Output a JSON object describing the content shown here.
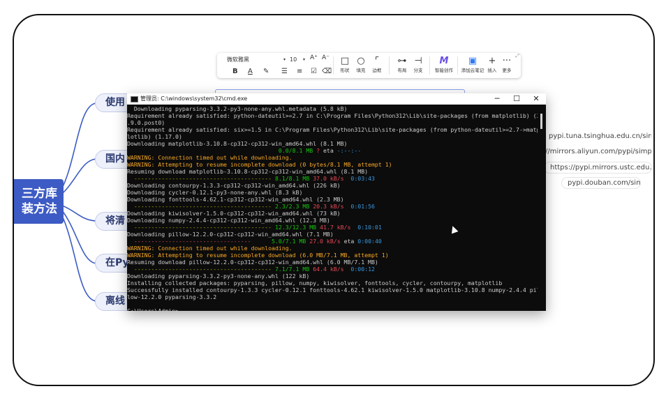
{
  "root_node": {
    "line1": "三方库",
    "line2": "装方法"
  },
  "branches": [
    "使用",
    "国内",
    "将清",
    "在Py",
    "离线"
  ],
  "mirror_links": [
    "pypi.tuna.tsinghua.edu.cn/simple",
    "//mirrors.aliyun.com/pypi/simple/",
    "https://pypi.mirrors.ustc.edu.cn/sim",
    "pypi.douban.com/simple"
  ],
  "toolbar": {
    "font_name": "微软雅黑",
    "font_size": "10",
    "grow_font": "A⁺",
    "shrink_font": "A⁻",
    "bold": "B",
    "font_color": "A",
    "highlight": "✎",
    "list": "☰",
    "align": "≡",
    "tools": [
      {
        "icon": "□",
        "label": "形状",
        "name": "shape"
      },
      {
        "icon": "○",
        "label": "填充",
        "name": "fill"
      },
      {
        "icon": "⌜",
        "label": "边框",
        "name": "border"
      },
      {
        "icon": "⊶",
        "label": "布局",
        "name": "layout"
      },
      {
        "icon": "⊣",
        "label": "分支",
        "name": "branch"
      },
      {
        "icon": "M",
        "label": "智能创作",
        "name": "ai-create"
      },
      {
        "icon": "▣",
        "label": "添加云笔记",
        "name": "add-cloud-note"
      },
      {
        "icon": "+",
        "label": "插入",
        "name": "insert"
      },
      {
        "icon": "···",
        "label": "更多",
        "name": "more"
      }
    ],
    "colors": {
      "ai": "#6b4de6",
      "note": "#2f7bf5"
    }
  },
  "cmd_window": {
    "title": "管理员: C:\\windows\\system32\\cmd.exe",
    "minimize": "─",
    "maximize": "☐",
    "close": "✕",
    "lines": [
      [
        {
          "t": "  Downloading pyparsing-3.3.2-py3-none-any.whl.metadata (5.8 kB)",
          "c": "#cccccc"
        }
      ],
      [
        {
          "t": "Requirement already satisfied: python-dateutil>=2.7 in C:\\Program Files\\Python312\\Lib\\site-packages (from matplotlib) (2",
          "c": "#cccccc"
        }
      ],
      [
        {
          "t": ".9.0.post0)",
          "c": "#cccccc"
        }
      ],
      [
        {
          "t": "Requirement already satisfied: six>=1.5 in C:\\Program Files\\Python312\\Lib\\site-packages (from python-dateutil>=2.7->matp",
          "c": "#cccccc"
        }
      ],
      [
        {
          "t": "lotlib) (1.17.0)",
          "c": "#cccccc"
        }
      ],
      [
        {
          "t": "Downloading matplotlib-3.10.8-cp312-cp312-win_amd64.whl (8.1 MB)",
          "c": "#cccccc"
        }
      ],
      [
        {
          "t": "                                            ",
          "c": "#cccccc"
        },
        {
          "t": "0.0/8.1 MB",
          "c": "#16c60c"
        },
        {
          "t": " ? ",
          "c": "#e74856"
        },
        {
          "t": "eta ",
          "c": "#cccccc"
        },
        {
          "t": "-:--:--",
          "c": "#3a96dd"
        }
      ],
      [
        {
          "t": "WARNING: Connection timed out while downloading.",
          "c": "#f9a825"
        }
      ],
      [
        {
          "t": "WARNING: Attempting to resume incomplete download (0 bytes/8.1 MB, attempt 1)",
          "c": "#f9a825"
        }
      ],
      [
        {
          "t": "Resuming download matplotlib-3.10.8-cp312-cp312-win_amd64.whl (8.1 MB)",
          "c": "#cccccc"
        }
      ],
      [
        {
          "t": "  ----------------------------------------",
          "c": "#b1b100"
        },
        {
          "t": " 8.1/8.1 MB",
          "c": "#16c60c"
        },
        {
          "t": " 37.0 kB/s",
          "c": "#e74856"
        },
        {
          "t": "  0:03:43",
          "c": "#3a96dd"
        }
      ],
      [
        {
          "t": "Downloading contourpy-1.3.3-cp312-cp312-win_amd64.whl (226 kB)",
          "c": "#cccccc"
        }
      ],
      [
        {
          "t": "Downloading cycler-0.12.1-py3-none-any.whl (8.3 kB)",
          "c": "#cccccc"
        }
      ],
      [
        {
          "t": "Downloading fonttools-4.62.1-cp312-cp312-win_amd64.whl (2.3 MB)",
          "c": "#cccccc"
        }
      ],
      [
        {
          "t": "  ----------------------------------------",
          "c": "#b1b100"
        },
        {
          "t": " 2.3/2.3 MB",
          "c": "#16c60c"
        },
        {
          "t": " 20.3 kB/s",
          "c": "#e74856"
        },
        {
          "t": "  0:01:56",
          "c": "#3a96dd"
        }
      ],
      [
        {
          "t": "Downloading kiwisolver-1.5.0-cp312-cp312-win_amd64.whl (73 kB)",
          "c": "#cccccc"
        }
      ],
      [
        {
          "t": "Downloading numpy-2.4.4-cp312-cp312-win_amd64.whl (12.3 MB)",
          "c": "#cccccc"
        }
      ],
      [
        {
          "t": "  ----------------------------------------",
          "c": "#b1b100"
        },
        {
          "t": " 12.3/12.3 MB",
          "c": "#16c60c"
        },
        {
          "t": " 41.7 kB/s",
          "c": "#e74856"
        },
        {
          "t": "  0:10:01",
          "c": "#3a96dd"
        }
      ],
      [
        {
          "t": "Downloading pillow-12.2.0-cp312-cp312-win_amd64.whl (7.1 MB)",
          "c": "#cccccc"
        }
      ],
      [
        {
          "t": "  ----------------------------------",
          "c": "#e74856"
        },
        {
          "t": "      5.0/7.1 MB",
          "c": "#16c60c"
        },
        {
          "t": " 27.0 kB/s",
          "c": "#e74856"
        },
        {
          "t": " eta ",
          "c": "#cccccc"
        },
        {
          "t": "0:00:40",
          "c": "#3a96dd"
        }
      ],
      [
        {
          "t": "WARNING: Connection timed out while downloading.",
          "c": "#f9a825"
        }
      ],
      [
        {
          "t": "WARNING: Attempting to resume incomplete download (6.0 MB/7.1 MB, attempt 1)",
          "c": "#f9a825"
        }
      ],
      [
        {
          "t": "Resuming download pillow-12.2.0-cp312-cp312-win_amd64.whl (6.0 MB/7.1 MB)",
          "c": "#cccccc"
        }
      ],
      [
        {
          "t": "  ----------------------------------------",
          "c": "#b1b100"
        },
        {
          "t": " 7.1/7.1 MB",
          "c": "#16c60c"
        },
        {
          "t": " 64.4 kB/s",
          "c": "#e74856"
        },
        {
          "t": "  0:00:12",
          "c": "#3a96dd"
        }
      ],
      [
        {
          "t": "Downloading pyparsing-3.3.2-py3-none-any.whl (122 kB)",
          "c": "#cccccc"
        }
      ],
      [
        {
          "t": "Installing collected packages: pyparsing, pillow, numpy, kiwisolver, fonttools, cycler, contourpy, matplotlib",
          "c": "#cccccc"
        }
      ],
      [
        {
          "t": "Successfully installed contourpy-1.3.3 cycler-0.12.1 fonttools-4.62.1 kiwisolver-1.5.0 matplotlib-3.10.8 numpy-2.4.4 pil",
          "c": "#cccccc"
        }
      ],
      [
        {
          "t": "low-12.2.0 pyparsing-3.3.2",
          "c": "#cccccc"
        }
      ],
      [
        {
          "t": "",
          "c": "#cccccc"
        }
      ],
      [
        {
          "t": "C:\\Users\\Admin>",
          "c": "#cccccc"
        }
      ]
    ]
  }
}
